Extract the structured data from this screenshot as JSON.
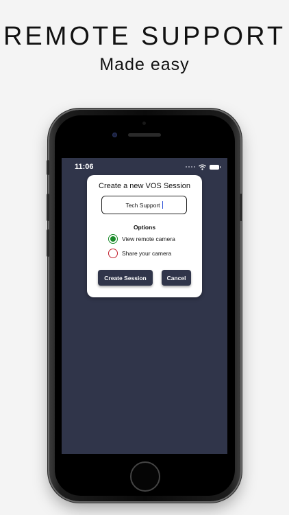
{
  "header": {
    "title": "REMOTE SUPPORT",
    "subtitle": "Made easy"
  },
  "status_bar": {
    "time": "11:06",
    "icons": [
      "signal-dots-icon",
      "wifi-icon",
      "battery-icon"
    ]
  },
  "dialog": {
    "title": "Create a new VOS Session",
    "session_name_value": "Tech Support",
    "options_label": "Options",
    "options": [
      {
        "label": "View remote camera",
        "selected": true
      },
      {
        "label": "Share your camera",
        "selected": false
      }
    ],
    "create_label": "Create Session",
    "cancel_label": "Cancel"
  },
  "colors": {
    "screen_background": "#30354a",
    "selected_radio": "#1a8a2a",
    "unselected_radio": "#c21f2c",
    "button_background": "#30354a"
  }
}
